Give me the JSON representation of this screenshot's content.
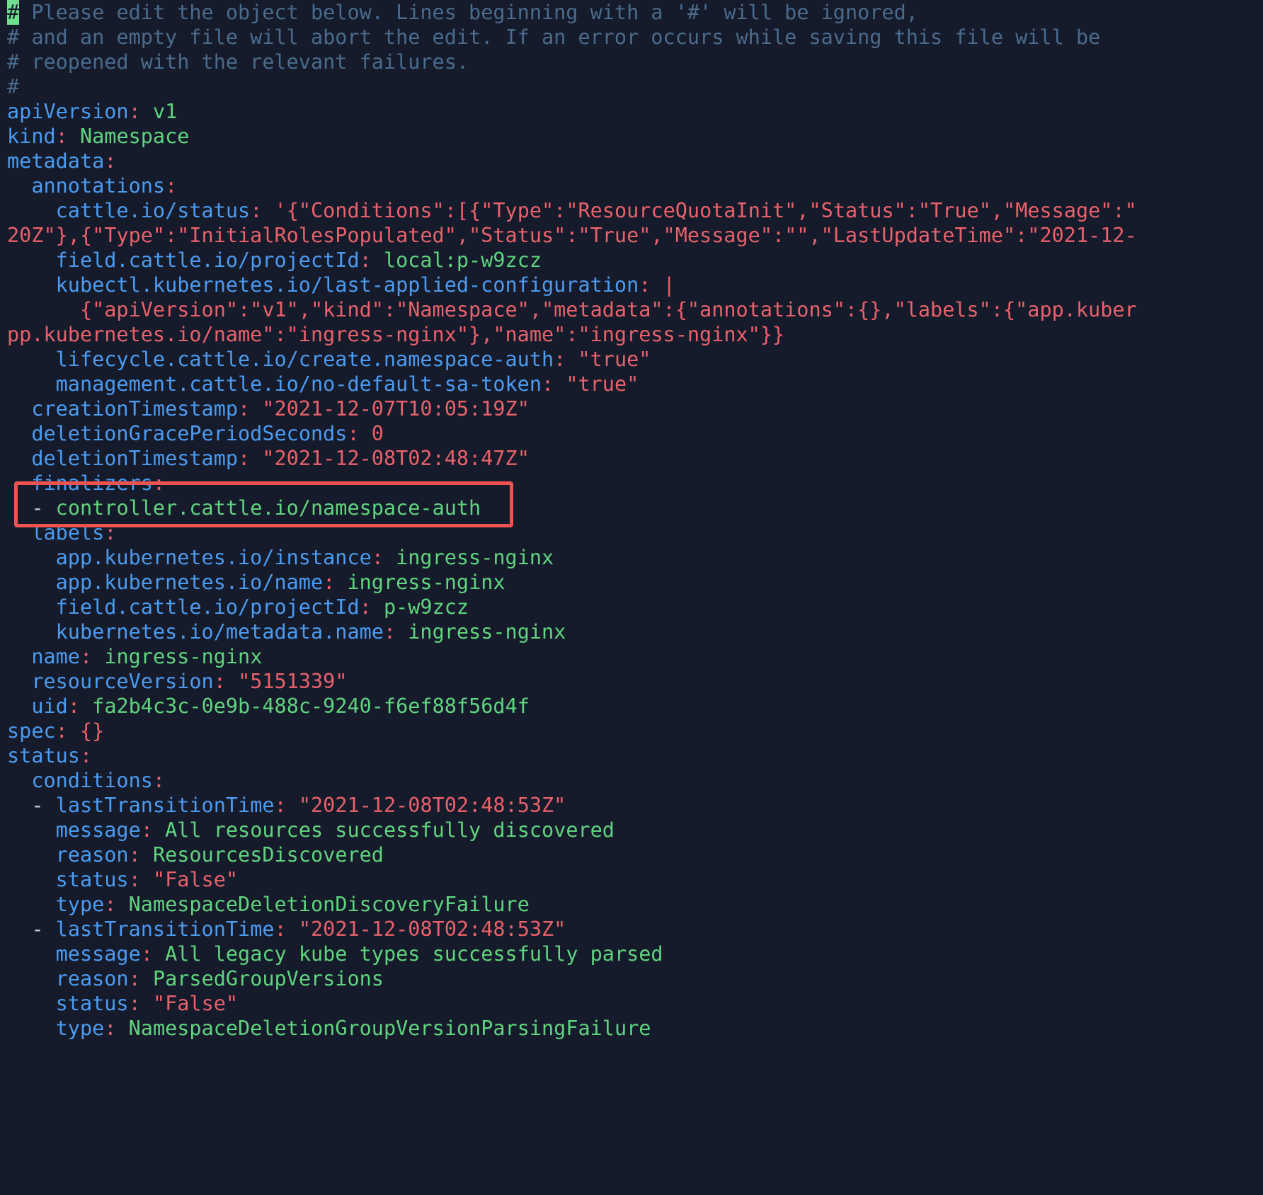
{
  "editor": {
    "app": "kubectl-edit-yaml-terminal",
    "colors": {
      "background": "#161b2b",
      "comment": "#4a6b8c",
      "key": "#4b9bf0",
      "punctuation": "#e8616b",
      "string": "#e8616b",
      "value": "#5fd47e",
      "cursor_background": "#6ede8f",
      "annotation_box": "#ef5350"
    },
    "cursor": {
      "character": "#",
      "line": 1,
      "column": 1
    }
  },
  "annotation": {
    "name": "finalizers-highlight-box",
    "color": "#ef5350",
    "targets": [
      "finalizers:",
      "- controller.cattle.io/namespace-auth"
    ]
  },
  "lines": [
    {
      "id": 1,
      "parts": [
        {
          "t": "cursor",
          "v": "#"
        },
        {
          "t": "comment",
          "v": " Please edit the object below. Lines beginning with a '#' will be ignored,"
        }
      ]
    },
    {
      "id": 2,
      "parts": [
        {
          "t": "comment",
          "v": "# and an empty file will abort the edit. If an error occurs while saving this file will be"
        }
      ]
    },
    {
      "id": 3,
      "parts": [
        {
          "t": "comment",
          "v": "# reopened with the relevant failures."
        }
      ]
    },
    {
      "id": 4,
      "parts": [
        {
          "t": "comment",
          "v": "#"
        }
      ]
    },
    {
      "id": 5,
      "parts": [
        {
          "t": "key",
          "v": "apiVersion"
        },
        {
          "t": "punct",
          "v": ":"
        },
        {
          "t": "plain",
          "v": " "
        },
        {
          "t": "value",
          "v": "v1"
        }
      ]
    },
    {
      "id": 6,
      "parts": [
        {
          "t": "key",
          "v": "kind"
        },
        {
          "t": "punct",
          "v": ":"
        },
        {
          "t": "plain",
          "v": " "
        },
        {
          "t": "value",
          "v": "Namespace"
        }
      ]
    },
    {
      "id": 7,
      "parts": [
        {
          "t": "key",
          "v": "metadata"
        },
        {
          "t": "punct",
          "v": ":"
        }
      ]
    },
    {
      "id": 8,
      "parts": [
        {
          "t": "plain",
          "v": "  "
        },
        {
          "t": "key",
          "v": "annotations"
        },
        {
          "t": "punct",
          "v": ":"
        }
      ]
    },
    {
      "id": 9,
      "parts": [
        {
          "t": "plain",
          "v": "    "
        },
        {
          "t": "key",
          "v": "cattle.io/status"
        },
        {
          "t": "punct",
          "v": ":"
        },
        {
          "t": "plain",
          "v": " "
        },
        {
          "t": "string",
          "v": "'{\"Conditions\":[{\"Type\":\"ResourceQuotaInit\",\"Status\":\"True\",\"Message\":\""
        }
      ]
    },
    {
      "id": 10,
      "parts": [
        {
          "t": "string",
          "v": "20Z\"},{\"Type\":\"InitialRolesPopulated\",\"Status\":\"True\",\"Message\":\"\",\"LastUpdateTime\":\"2021-12-"
        }
      ]
    },
    {
      "id": 11,
      "parts": [
        {
          "t": "plain",
          "v": "    "
        },
        {
          "t": "key",
          "v": "field.cattle.io/projectId"
        },
        {
          "t": "punct",
          "v": ":"
        },
        {
          "t": "plain",
          "v": " "
        },
        {
          "t": "value",
          "v": "local:p-w9zcz"
        }
      ]
    },
    {
      "id": 12,
      "parts": [
        {
          "t": "plain",
          "v": "    "
        },
        {
          "t": "key",
          "v": "kubectl.kubernetes.io/last-applied-configuration"
        },
        {
          "t": "punct",
          "v": ":"
        },
        {
          "t": "plain",
          "v": " "
        },
        {
          "t": "punct",
          "v": "|"
        }
      ]
    },
    {
      "id": 13,
      "parts": [
        {
          "t": "plain",
          "v": "      "
        },
        {
          "t": "string",
          "v": "{\"apiVersion\":\"v1\",\"kind\":\"Namespace\",\"metadata\":{\"annotations\":{},\"labels\":{\"app.kuber"
        }
      ]
    },
    {
      "id": 14,
      "parts": [
        {
          "t": "string",
          "v": "pp.kubernetes.io/name\":\"ingress-nginx\"},\"name\":\"ingress-nginx\"}}"
        }
      ]
    },
    {
      "id": 15,
      "parts": [
        {
          "t": "plain",
          "v": "    "
        },
        {
          "t": "key",
          "v": "lifecycle.cattle.io/create.namespace-auth"
        },
        {
          "t": "punct",
          "v": ":"
        },
        {
          "t": "plain",
          "v": " "
        },
        {
          "t": "string",
          "v": "\"true\""
        }
      ]
    },
    {
      "id": 16,
      "parts": [
        {
          "t": "plain",
          "v": "    "
        },
        {
          "t": "key",
          "v": "management.cattle.io/no-default-sa-token"
        },
        {
          "t": "punct",
          "v": ":"
        },
        {
          "t": "plain",
          "v": " "
        },
        {
          "t": "string",
          "v": "\"true\""
        }
      ]
    },
    {
      "id": 17,
      "parts": [
        {
          "t": "plain",
          "v": "  "
        },
        {
          "t": "key",
          "v": "creationTimestamp"
        },
        {
          "t": "punct",
          "v": ":"
        },
        {
          "t": "plain",
          "v": " "
        },
        {
          "t": "string",
          "v": "\"2021-12-07T10:05:19Z\""
        }
      ]
    },
    {
      "id": 18,
      "parts": [
        {
          "t": "plain",
          "v": "  "
        },
        {
          "t": "key",
          "v": "deletionGracePeriodSeconds"
        },
        {
          "t": "punct",
          "v": ":"
        },
        {
          "t": "plain",
          "v": " "
        },
        {
          "t": "num",
          "v": "0"
        }
      ]
    },
    {
      "id": 19,
      "parts": [
        {
          "t": "plain",
          "v": "  "
        },
        {
          "t": "key",
          "v": "deletionTimestamp"
        },
        {
          "t": "punct",
          "v": ":"
        },
        {
          "t": "plain",
          "v": " "
        },
        {
          "t": "string",
          "v": "\"2021-12-08T02:48:47Z\""
        }
      ]
    },
    {
      "id": 20,
      "parts": [
        {
          "t": "plain",
          "v": "  "
        },
        {
          "t": "key",
          "v": "finalizers"
        },
        {
          "t": "punct",
          "v": ":"
        }
      ]
    },
    {
      "id": 21,
      "parts": [
        {
          "t": "plain",
          "v": "  "
        },
        {
          "t": "dash",
          "v": "- "
        },
        {
          "t": "value",
          "v": "controller.cattle.io/namespace-auth"
        }
      ]
    },
    {
      "id": 22,
      "parts": [
        {
          "t": "plain",
          "v": "  "
        },
        {
          "t": "key",
          "v": "labels"
        },
        {
          "t": "punct",
          "v": ":"
        }
      ]
    },
    {
      "id": 23,
      "parts": [
        {
          "t": "plain",
          "v": "    "
        },
        {
          "t": "key",
          "v": "app.kubernetes.io/instance"
        },
        {
          "t": "punct",
          "v": ":"
        },
        {
          "t": "plain",
          "v": " "
        },
        {
          "t": "value",
          "v": "ingress-nginx"
        }
      ]
    },
    {
      "id": 24,
      "parts": [
        {
          "t": "plain",
          "v": "    "
        },
        {
          "t": "key",
          "v": "app.kubernetes.io/name"
        },
        {
          "t": "punct",
          "v": ":"
        },
        {
          "t": "plain",
          "v": " "
        },
        {
          "t": "value",
          "v": "ingress-nginx"
        }
      ]
    },
    {
      "id": 25,
      "parts": [
        {
          "t": "plain",
          "v": "    "
        },
        {
          "t": "key",
          "v": "field.cattle.io/projectId"
        },
        {
          "t": "punct",
          "v": ":"
        },
        {
          "t": "plain",
          "v": " "
        },
        {
          "t": "value",
          "v": "p-w9zcz"
        }
      ]
    },
    {
      "id": 26,
      "parts": [
        {
          "t": "plain",
          "v": "    "
        },
        {
          "t": "key",
          "v": "kubernetes.io/metadata.name"
        },
        {
          "t": "punct",
          "v": ":"
        },
        {
          "t": "plain",
          "v": " "
        },
        {
          "t": "value",
          "v": "ingress-nginx"
        }
      ]
    },
    {
      "id": 27,
      "parts": [
        {
          "t": "plain",
          "v": "  "
        },
        {
          "t": "key",
          "v": "name"
        },
        {
          "t": "punct",
          "v": ":"
        },
        {
          "t": "plain",
          "v": " "
        },
        {
          "t": "value",
          "v": "ingress-nginx"
        }
      ]
    },
    {
      "id": 28,
      "parts": [
        {
          "t": "plain",
          "v": "  "
        },
        {
          "t": "key",
          "v": "resourceVersion"
        },
        {
          "t": "punct",
          "v": ":"
        },
        {
          "t": "plain",
          "v": " "
        },
        {
          "t": "string",
          "v": "\"5151339\""
        }
      ]
    },
    {
      "id": 29,
      "parts": [
        {
          "t": "plain",
          "v": "  "
        },
        {
          "t": "key",
          "v": "uid"
        },
        {
          "t": "punct",
          "v": ":"
        },
        {
          "t": "plain",
          "v": " "
        },
        {
          "t": "value",
          "v": "fa2b4c3c-0e9b-488c-9240-f6ef88f56d4f"
        }
      ]
    },
    {
      "id": 30,
      "parts": [
        {
          "t": "key",
          "v": "spec"
        },
        {
          "t": "punct",
          "v": ":"
        },
        {
          "t": "plain",
          "v": " "
        },
        {
          "t": "punct",
          "v": "{}"
        }
      ]
    },
    {
      "id": 31,
      "parts": [
        {
          "t": "key",
          "v": "status"
        },
        {
          "t": "punct",
          "v": ":"
        }
      ]
    },
    {
      "id": 32,
      "parts": [
        {
          "t": "plain",
          "v": "  "
        },
        {
          "t": "key",
          "v": "conditions"
        },
        {
          "t": "punct",
          "v": ":"
        }
      ]
    },
    {
      "id": 33,
      "parts": [
        {
          "t": "plain",
          "v": "  "
        },
        {
          "t": "dash",
          "v": "- "
        },
        {
          "t": "key",
          "v": "lastTransitionTime"
        },
        {
          "t": "punct",
          "v": ":"
        },
        {
          "t": "plain",
          "v": " "
        },
        {
          "t": "string",
          "v": "\"2021-12-08T02:48:53Z\""
        }
      ]
    },
    {
      "id": 34,
      "parts": [
        {
          "t": "plain",
          "v": "    "
        },
        {
          "t": "key",
          "v": "message"
        },
        {
          "t": "punct",
          "v": ":"
        },
        {
          "t": "plain",
          "v": " "
        },
        {
          "t": "value",
          "v": "All resources successfully discovered"
        }
      ]
    },
    {
      "id": 35,
      "parts": [
        {
          "t": "plain",
          "v": "    "
        },
        {
          "t": "key",
          "v": "reason"
        },
        {
          "t": "punct",
          "v": ":"
        },
        {
          "t": "plain",
          "v": " "
        },
        {
          "t": "value",
          "v": "ResourcesDiscovered"
        }
      ]
    },
    {
      "id": 36,
      "parts": [
        {
          "t": "plain",
          "v": "    "
        },
        {
          "t": "key",
          "v": "status"
        },
        {
          "t": "punct",
          "v": ":"
        },
        {
          "t": "plain",
          "v": " "
        },
        {
          "t": "string",
          "v": "\"False\""
        }
      ]
    },
    {
      "id": 37,
      "parts": [
        {
          "t": "plain",
          "v": "    "
        },
        {
          "t": "key",
          "v": "type"
        },
        {
          "t": "punct",
          "v": ":"
        },
        {
          "t": "plain",
          "v": " "
        },
        {
          "t": "value",
          "v": "NamespaceDeletionDiscoveryFailure"
        }
      ]
    },
    {
      "id": 38,
      "parts": [
        {
          "t": "plain",
          "v": "  "
        },
        {
          "t": "dash",
          "v": "- "
        },
        {
          "t": "key",
          "v": "lastTransitionTime"
        },
        {
          "t": "punct",
          "v": ":"
        },
        {
          "t": "plain",
          "v": " "
        },
        {
          "t": "string",
          "v": "\"2021-12-08T02:48:53Z\""
        }
      ]
    },
    {
      "id": 39,
      "parts": [
        {
          "t": "plain",
          "v": "    "
        },
        {
          "t": "key",
          "v": "message"
        },
        {
          "t": "punct",
          "v": ":"
        },
        {
          "t": "plain",
          "v": " "
        },
        {
          "t": "value",
          "v": "All legacy kube types successfully parsed"
        }
      ]
    },
    {
      "id": 40,
      "parts": [
        {
          "t": "plain",
          "v": "    "
        },
        {
          "t": "key",
          "v": "reason"
        },
        {
          "t": "punct",
          "v": ":"
        },
        {
          "t": "plain",
          "v": " "
        },
        {
          "t": "value",
          "v": "ParsedGroupVersions"
        }
      ]
    },
    {
      "id": 41,
      "parts": [
        {
          "t": "plain",
          "v": "    "
        },
        {
          "t": "key",
          "v": "status"
        },
        {
          "t": "punct",
          "v": ":"
        },
        {
          "t": "plain",
          "v": " "
        },
        {
          "t": "string",
          "v": "\"False\""
        }
      ]
    },
    {
      "id": 42,
      "parts": [
        {
          "t": "plain",
          "v": "    "
        },
        {
          "t": "key",
          "v": "type"
        },
        {
          "t": "punct",
          "v": ":"
        },
        {
          "t": "plain",
          "v": " "
        },
        {
          "t": "value",
          "v": "NamespaceDeletionGroupVersionParsingFailure"
        }
      ]
    }
  ]
}
